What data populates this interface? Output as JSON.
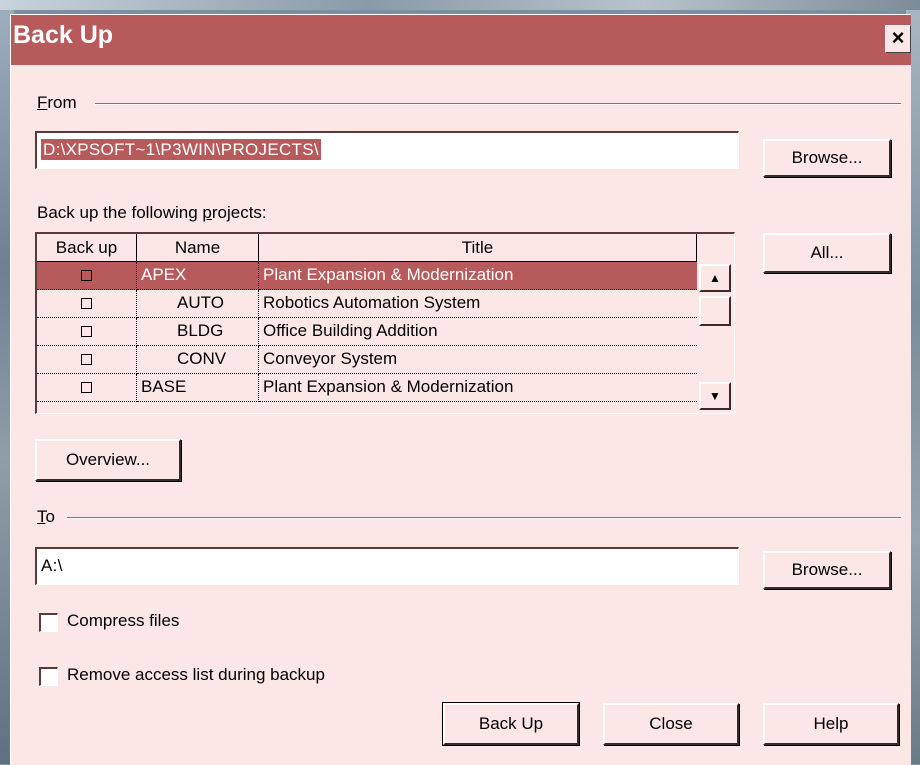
{
  "window": {
    "title": "Back Up",
    "close_glyph": "×"
  },
  "from": {
    "label_hotkey": "F",
    "label_rest": "rom",
    "path": "D:\\XPSOFT~1\\P3WIN\\PROJECTS\\",
    "browse_label": "Browse..."
  },
  "projects": {
    "label_pre": "Back up the following ",
    "label_hotkey": "p",
    "label_post": "rojects:",
    "columns": [
      "Back up",
      "Name",
      "Title"
    ],
    "rows": [
      {
        "name": "APEX",
        "title": "Plant Expansion & Modernization",
        "checked": false,
        "selected": true,
        "indent": false
      },
      {
        "name": "AUTO",
        "title": "Robotics Automation System",
        "checked": false,
        "selected": false,
        "indent": true
      },
      {
        "name": "BLDG",
        "title": "Office Building Addition",
        "checked": false,
        "selected": false,
        "indent": true
      },
      {
        "name": "CONV",
        "title": "Conveyor System",
        "checked": false,
        "selected": false,
        "indent": true
      },
      {
        "name": "BASE",
        "title": "Plant Expansion & Modernization",
        "checked": false,
        "selected": false,
        "indent": false
      }
    ],
    "all_label": "All...",
    "scroll_up_icon": "▲",
    "scroll_down_icon": "▼"
  },
  "overview_label": "Overview...",
  "to": {
    "label_hotkey": "T",
    "label_rest": "o",
    "path": "A:\\",
    "browse_label": "Browse..."
  },
  "options": {
    "compress_label": "Compress files",
    "compress_checked": false,
    "remove_access_label": "Remove access list during backup",
    "remove_access_checked": false
  },
  "buttons": {
    "backup": "Back Up",
    "close": "Close",
    "help": "Help"
  },
  "colors": {
    "accent": "#b65a5c",
    "face": "#fde6e6"
  }
}
